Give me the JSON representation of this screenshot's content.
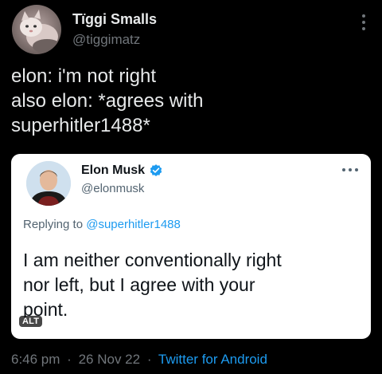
{
  "author": {
    "name": "Tïggi Smalls",
    "handle": "@tiggimatz",
    "avatar_icon": "cat-avatar"
  },
  "tweet": {
    "lines": [
      "elon: i'm not right",
      "also elon: *agrees with",
      "superhitler1488*"
    ]
  },
  "quoted": {
    "name": "Elon Musk",
    "handle": "@elonmusk",
    "verified": true,
    "reply_prefix": "Replying to",
    "reply_to": "@superhitler1488",
    "lines": [
      "I am neither conventionally right",
      "nor left, but I agree with your",
      "point."
    ],
    "alt_badge": "ALT",
    "background": "#ffffff"
  },
  "meta": {
    "time": "6:46 pm",
    "separator": "·",
    "date": "26 Nov 22",
    "source": "Twitter for Android"
  },
  "colors": {
    "background": "#000000",
    "link": "#1d9bf0",
    "muted": "#71767b",
    "verified": "#1d9bf0"
  }
}
